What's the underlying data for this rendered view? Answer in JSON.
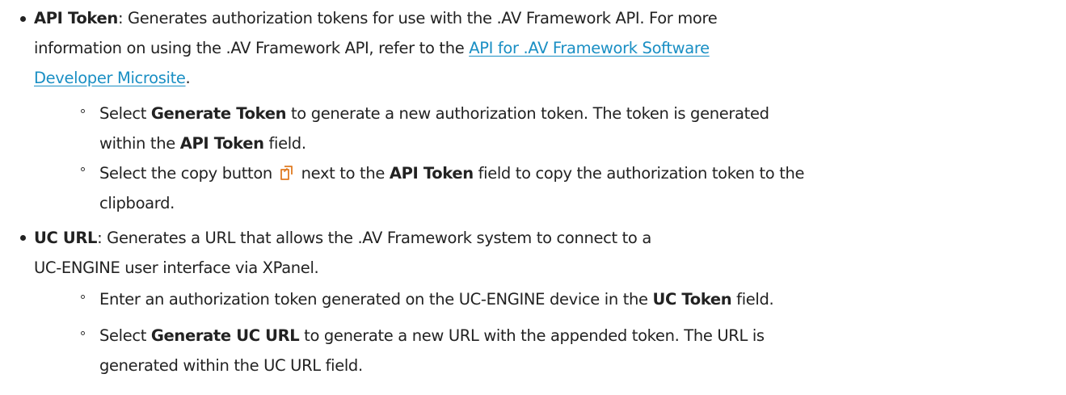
{
  "items": [
    {
      "term": "API Token",
      "description": {
        "text1": ": Generates authorization tokens for use with the .AV Framework API. For more",
        "text2": "information on using the .AV Framework API, refer to the ",
        "link_line1": "API for .AV Framework Software ",
        "link_line2": "Developer Microsite",
        "end": "."
      },
      "subitems": [
        {
          "pre": "Select ",
          "bold1": "Generate Token",
          "mid": " to generate a new authorization token. The token is generated",
          "line2_pre": "within the ",
          "bold2": "API Token",
          "line2_post": " field."
        },
        {
          "pre": "Select the copy button ",
          "icon": "copy-icon",
          "mid": " next to the ",
          "bold1": "API Token",
          "post": " field to copy the authorization token to the",
          "line2": "clipboard."
        }
      ]
    },
    {
      "term": "UC URL",
      "description": {
        "text1": ": Generates a URL that allows the .AV Framework system to connect to a",
        "text2": "UC-ENGINE user interface via XPanel."
      },
      "subitems": [
        {
          "pre": "Enter an authorization token generated on the UC-ENGINE device in the ",
          "bold1": "UC Token",
          "post": " field."
        },
        {
          "pre": "Select ",
          "bold1": "Generate UC URL",
          "mid": " to generate a new URL with the appended token. The URL is",
          "line2": "generated within the UC URL field."
        }
      ]
    }
  ],
  "colors": {
    "text": "#222222",
    "link": "#1a8fc4",
    "icon": "#e07b22"
  }
}
